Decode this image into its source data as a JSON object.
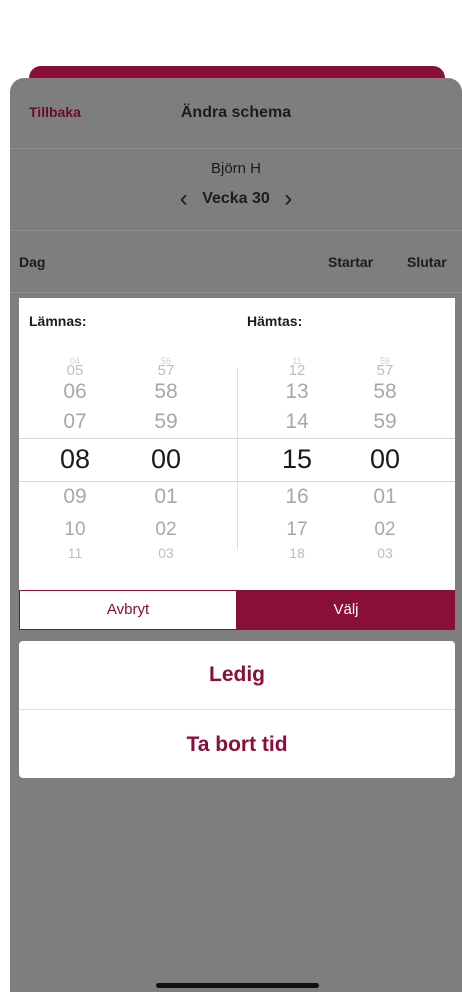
{
  "header": {
    "back_label": "Tillbaka",
    "title": "Ändra schema",
    "person": "Björn H",
    "week": "Vecka 30",
    "prev_icon": "chevron-left-icon",
    "next_icon": "chevron-right-icon"
  },
  "table_header": {
    "day": "Dag",
    "starts": "Startar",
    "ends": "Slutar"
  },
  "picker": {
    "drop_label": "Lämnas:",
    "pickup_label": "Hämtas:",
    "drop_hour": {
      "items": [
        "04",
        "05",
        "06",
        "07",
        "08",
        "09",
        "10",
        "11"
      ],
      "selected": "08"
    },
    "drop_minute": {
      "items": [
        "56",
        "57",
        "58",
        "59",
        "00",
        "01",
        "02",
        "03"
      ],
      "selected": "00"
    },
    "pickup_hour": {
      "items": [
        "11",
        "12",
        "13",
        "14",
        "15",
        "16",
        "17",
        "18"
      ],
      "selected": "15"
    },
    "pickup_minute": {
      "items": [
        "56",
        "57",
        "58",
        "59",
        "00",
        "01",
        "02",
        "03"
      ],
      "selected": "00"
    },
    "cancel_label": "Avbryt",
    "choose_label": "Välj"
  },
  "actions": {
    "free_label": "Ledig",
    "remove_label": "Ta bort tid"
  },
  "colors": {
    "accent": "#8a0e3a",
    "overlay": "#7e7e7e"
  }
}
